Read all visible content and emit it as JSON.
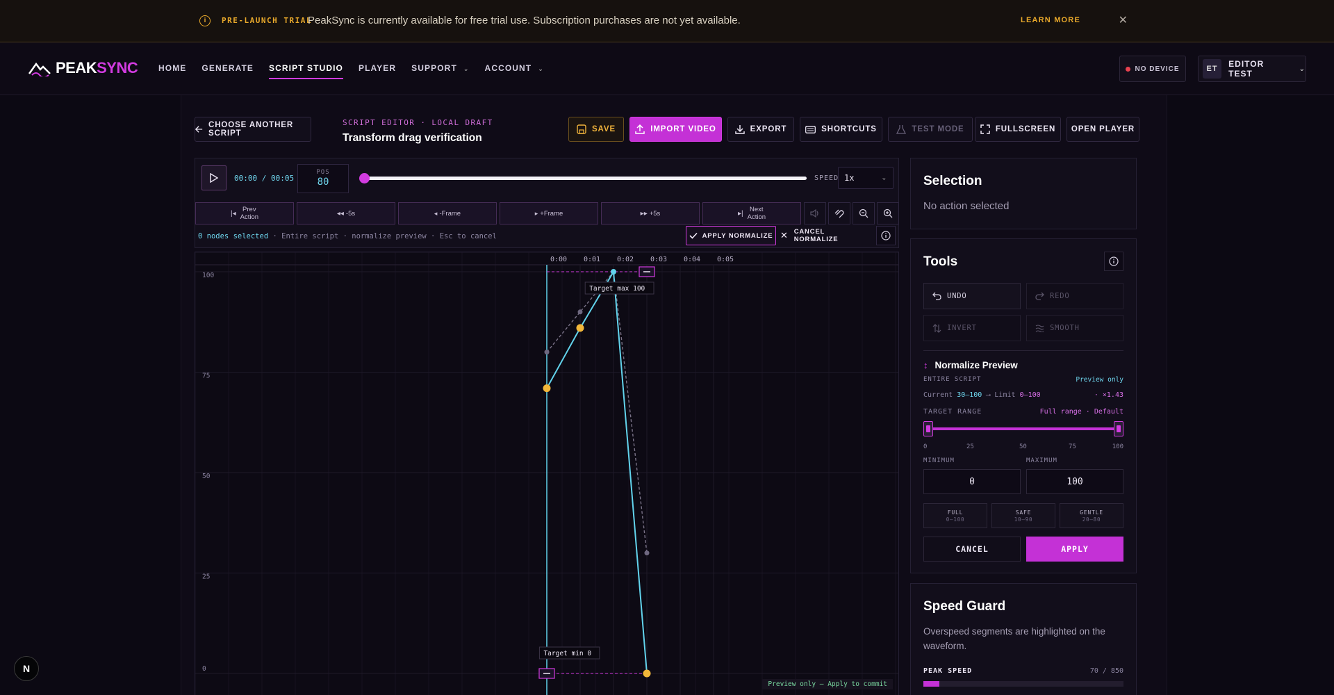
{
  "banner": {
    "tag": "PRE-LAUNCH TRIAL",
    "message": "PeakSync is currently available for free trial use. Subscription purchases are not yet available.",
    "learn_more": "LEARN MORE"
  },
  "nav": {
    "logo_peak": "PEAK",
    "logo_sync": "SYNC",
    "links": [
      "HOME",
      "GENERATE",
      "SCRIPT STUDIO",
      "PLAYER",
      "SUPPORT",
      "ACCOUNT"
    ],
    "device": "NO DEVICE",
    "user_initials": "ET",
    "user_name": "EDITOR TEST"
  },
  "toolbar": {
    "back": "CHOOSE ANOTHER SCRIPT",
    "editor_label": "SCRIPT EDITOR · LOCAL DRAFT",
    "title": "Transform drag verification",
    "save": "SAVE",
    "import": "IMPORT VIDEO",
    "export": "EXPORT",
    "shortcuts": "SHORTCUTS",
    "test_mode": "TEST MODE",
    "fullscreen": "FULLSCREEN",
    "open_player": "OPEN PLAYER"
  },
  "transport": {
    "time": "00:00 / 00:05",
    "pos_label": "POS",
    "pos_value": "80",
    "speed_label": "SPEED",
    "speed_value": "1x",
    "progress": 0,
    "steps": [
      {
        "l1": "Prev",
        "l2": "Action",
        "icon": "prev-action"
      },
      {
        "l1": "-5s",
        "l2": "",
        "icon": "rewind"
      },
      {
        "l1": "-Frame",
        "l2": "",
        "icon": "step-back"
      },
      {
        "l1": "+Frame",
        "l2": "",
        "icon": "step-forward"
      },
      {
        "l1": "+5s",
        "l2": "",
        "icon": "fast-forward"
      },
      {
        "l1": "Next",
        "l2": "Action",
        "icon": "next-action"
      }
    ],
    "sel_count": "0 nodes selected",
    "sel_rest": " · Entire script · normalize preview · Esc to cancel",
    "apply_normalize": "APPLY NORMALIZE",
    "cancel_normalize": "CANCEL NORMALIZE"
  },
  "graph": {
    "time_ticks": [
      "0:00",
      "0:01",
      "0:02",
      "0:03",
      "0:04",
      "0:05"
    ],
    "y_ticks": [
      "100",
      "75",
      "50",
      "25",
      "0"
    ],
    "target_max": "Target max 100",
    "target_min": "Target min 0",
    "preview_note": "Preview only — Apply to commit",
    "original_points": [
      {
        "t": 0.0,
        "pos": 80
      },
      {
        "t": 1.0,
        "pos": 90
      },
      {
        "t": 2.0,
        "pos": 100
      },
      {
        "t": 3.0,
        "pos": 30
      }
    ],
    "preview_points": [
      {
        "t": 0.0,
        "pos": 71
      },
      {
        "t": 1.0,
        "pos": 86
      },
      {
        "t": 2.0,
        "pos": 100
      },
      {
        "t": 3.0,
        "pos": 0
      }
    ],
    "colors": {
      "line": "#62d3ec",
      "node": "#f2b73a",
      "ghost": "#7a7388",
      "accent": "#d23be0"
    }
  },
  "selection": {
    "title": "Selection",
    "empty": "No action selected"
  },
  "tools": {
    "title": "Tools",
    "undo": "UNDO",
    "redo": "REDO",
    "invert": "INVERT",
    "smooth": "SMOOTH",
    "normalize_title": "Normalize Preview",
    "scope": "ENTIRE SCRIPT",
    "preview_only": "Preview only",
    "current_label": "Current",
    "current_range": "30–100",
    "limit_label": "Limit",
    "limit_range": "0–100",
    "factor": "· ×1.43",
    "target_range": "TARGET RANGE",
    "target_mode": "Full range · Default",
    "range_min": 0,
    "range_max": 100,
    "slider_ticks": [
      "0",
      "25",
      "50",
      "75",
      "100"
    ],
    "min_label": "MINIMUM",
    "max_label": "MAXIMUM",
    "min_value": "0",
    "max_value": "100",
    "presets": [
      {
        "name": "FULL",
        "range": "0–100"
      },
      {
        "name": "SAFE",
        "range": "10–90"
      },
      {
        "name": "GENTLE",
        "range": "20–80"
      }
    ],
    "cancel": "CANCEL",
    "apply": "APPLY"
  },
  "speed_guard": {
    "title": "Speed Guard",
    "desc": "Overspeed segments are highlighted on the waveform.",
    "peak_label": "PEAK SPEED",
    "peak_value": "70 / 850",
    "peak_fraction": 0.08
  },
  "badge": "N"
}
